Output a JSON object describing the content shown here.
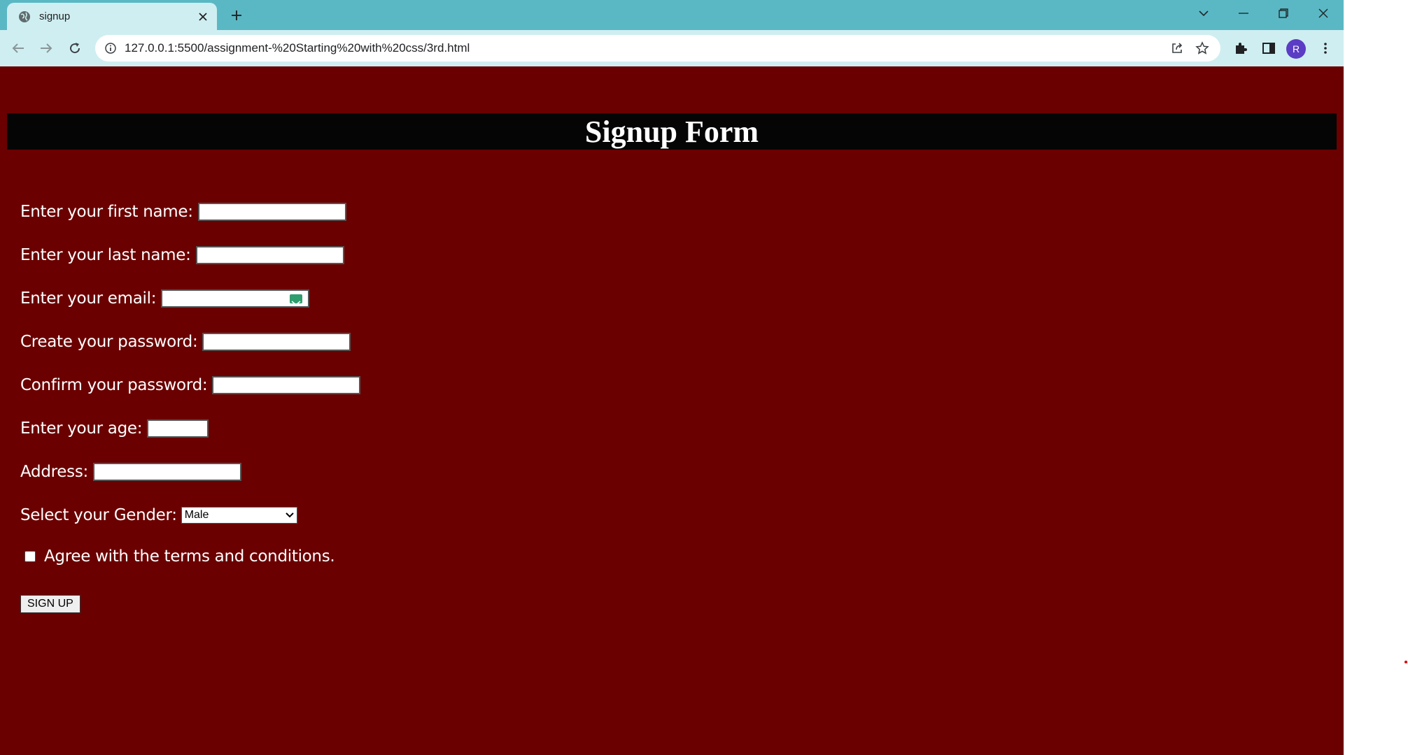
{
  "browser": {
    "tab_title": "signup",
    "url": "127.0.0.1:5500/assignment-%20Starting%20with%20css/3rd.html",
    "avatar_letter": "R"
  },
  "page": {
    "heading": "Signup Form",
    "fields": [
      {
        "label": "Enter your first name:",
        "value": ""
      },
      {
        "label": "Enter your last name:",
        "value": ""
      },
      {
        "label": "Enter your email:",
        "value": ""
      },
      {
        "label": "Create your password:",
        "value": ""
      },
      {
        "label": "Confirm your password:",
        "value": ""
      },
      {
        "label": "Enter your age:",
        "value": ""
      },
      {
        "label": "Address:",
        "value": ""
      }
    ],
    "gender": {
      "label": "Select your Gender:",
      "selected": "Male"
    },
    "terms_label": "Agree with the terms and conditions.",
    "submit_label": "SIGN UP"
  },
  "colors": {
    "titlebar": "#5ab8c4",
    "toolbar": "#cfeef1",
    "page_background": "#6b0000",
    "header_bar": "#050505"
  }
}
